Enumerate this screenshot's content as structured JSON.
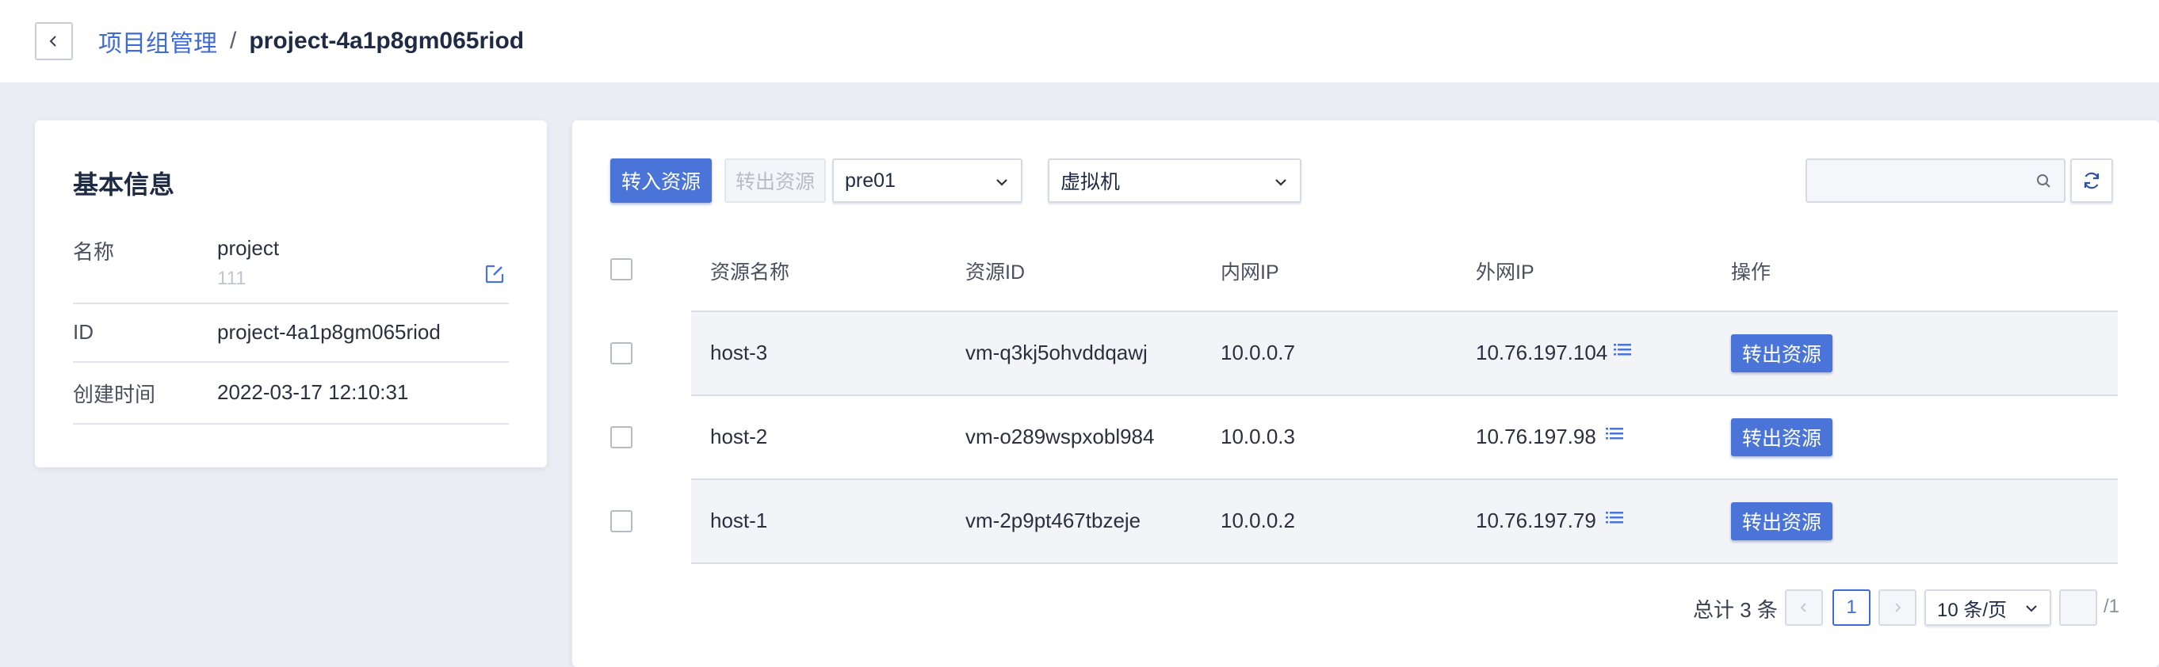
{
  "header": {
    "breadcrumb_parent": "项目组管理",
    "breadcrumb_sep": "/",
    "breadcrumb_current": "project-4a1p8gm065riod"
  },
  "info": {
    "title": "基本信息",
    "rows": [
      {
        "label": "名称",
        "value": "project",
        "sub": "111"
      },
      {
        "label": "ID",
        "value": "project-4a1p8gm065riod"
      },
      {
        "label": "创建时间",
        "value": "2022-03-17 12:10:31"
      }
    ]
  },
  "toolbar": {
    "transfer_in": "转入资源",
    "transfer_out": "转出资源",
    "region_select": "pre01",
    "type_select": "虚拟机",
    "search_placeholder": ""
  },
  "table": {
    "columns": [
      "资源名称",
      "资源ID",
      "内网IP",
      "外网IP",
      "操作"
    ],
    "rows": [
      {
        "name": "host-3",
        "id": "vm-q3kj5ohvddqawj",
        "private_ip": "10.0.0.7",
        "public_ip": "10.76.197.104",
        "action": "转出资源"
      },
      {
        "name": "host-2",
        "id": "vm-o289wspxobl984",
        "private_ip": "10.0.0.3",
        "public_ip": "10.76.197.98",
        "action": "转出资源"
      },
      {
        "name": "host-1",
        "id": "vm-2p9pt467tbzeje",
        "private_ip": "10.0.0.2",
        "public_ip": "10.76.197.79",
        "action": "转出资源"
      }
    ]
  },
  "pagination": {
    "total": "总计 3 条",
    "current_page": "1",
    "page_size": "10 条/页",
    "page_input": "",
    "page_of": "/1"
  },
  "colors": {
    "accent": "#4a74d8",
    "link": "#3f6bd8",
    "background": "#ebedf4"
  }
}
